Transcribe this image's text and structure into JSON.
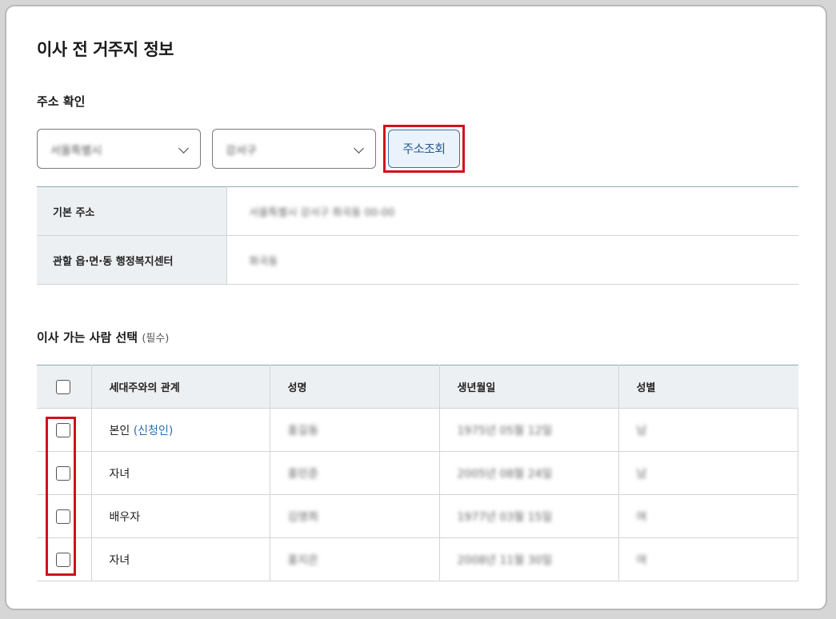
{
  "page_title": "이사 전 거주지 정보",
  "address_section": {
    "title": "주소 확인",
    "select_1": {
      "value": "서울특별시"
    },
    "select_2": {
      "value": "강서구"
    },
    "search_button": "주소조회"
  },
  "address_table": {
    "rows": [
      {
        "label": "기본 주소",
        "value": "서울특별시 강서구 화곡동 00-00"
      },
      {
        "label": "관할 읍·면·동 행정복지센터",
        "value": "화곡동"
      }
    ]
  },
  "people_section": {
    "title": "이사 가는 사람 선택",
    "required": "(필수)",
    "columns": [
      "세대주와의 관계",
      "성명",
      "생년월일",
      "성별"
    ],
    "rows": [
      {
        "relation": "본인",
        "note": "(신청인)",
        "name": "홍길동",
        "birth": "1975년 05월 12일",
        "gender": "남"
      },
      {
        "relation": "자녀",
        "note": "",
        "name": "홍민준",
        "birth": "2005년 08월 24일",
        "gender": "남"
      },
      {
        "relation": "배우자",
        "note": "",
        "name": "김영희",
        "birth": "1977년 03월 15일",
        "gender": "여"
      },
      {
        "relation": "자녀",
        "note": "",
        "name": "홍지은",
        "birth": "2008년 11월 30일",
        "gender": "여"
      }
    ]
  },
  "colors": {
    "highlight": "#d0121b",
    "accent": "#2b5a8c"
  }
}
